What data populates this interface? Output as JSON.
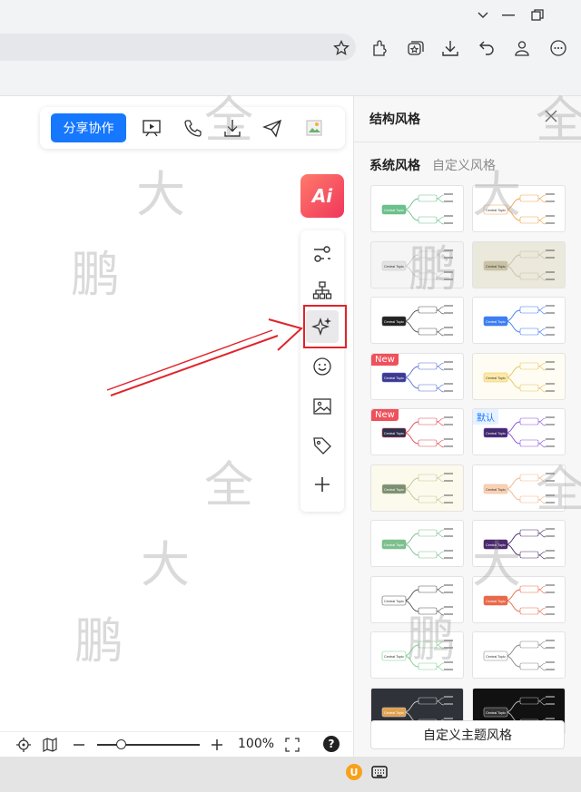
{
  "browser": {
    "controls": [
      "chevron-down-icon",
      "minimize-icon",
      "restore-icon"
    ],
    "toolbar_icons": [
      "star-icon",
      "extension-icon",
      "collections-icon",
      "download-icon",
      "undo-icon",
      "profile-icon",
      "more-icon"
    ]
  },
  "toolbar": {
    "share_label": "分享协作",
    "icons": [
      "present-icon",
      "phone-icon",
      "export-icon",
      "send-icon",
      "image-icon"
    ]
  },
  "ai_button": {
    "label": "Ai"
  },
  "side_tools": [
    "adjust-icon",
    "structure-icon",
    "magic-style-icon",
    "emoji-icon",
    "picture-icon",
    "tag-icon",
    "plus-icon"
  ],
  "bottom_bar": {
    "zoom_text": "100%",
    "zoom_level": 0.2,
    "help": "?"
  },
  "panel": {
    "title": "结构风格",
    "tab_system": "系统风格",
    "tab_custom": "自定义风格",
    "custom_theme_button": "自定义主题风格",
    "themes": [
      {
        "id": 1,
        "bg": "#ffffff",
        "center": "#6cc08b",
        "branch": "#6cc08b",
        "text": "Central Topic",
        "badge": ""
      },
      {
        "id": 2,
        "bg": "#ffffff",
        "center": "#ffffff",
        "branch": "#f0a24b",
        "text": "Central Topic",
        "badge": ""
      },
      {
        "id": 3,
        "bg": "#f5f5f5",
        "center": "#e3e3e3",
        "branch": "#cccccc",
        "text": "Central Topic",
        "badge": ""
      },
      {
        "id": 4,
        "bg": "#ebe8dc",
        "center": "#c9c2a5",
        "branch": "#c9c2a5",
        "text": "Central Topic",
        "badge": ""
      },
      {
        "id": 5,
        "bg": "#ffffff",
        "center": "#222222",
        "branch": "#555555",
        "text": "Central Topic",
        "badge": ""
      },
      {
        "id": 6,
        "bg": "#ffffff",
        "center": "#3e7ef2",
        "branch": "#3e7ef2",
        "text": "Central Topic",
        "badge": ""
      },
      {
        "id": 7,
        "bg": "#ffffff",
        "center": "#3d3b8e",
        "branch": "#5a6fd8",
        "text": "Central Topic",
        "badge": "New"
      },
      {
        "id": 8,
        "bg": "#fffdf3",
        "center": "#fde9a8",
        "branch": "#e8c25a",
        "text": "Central Topic",
        "badge": ""
      },
      {
        "id": 9,
        "bg": "#ffffff",
        "center": "#2c2f4a",
        "branch": "#e04a55",
        "text": "Central Topic",
        "badge": "New"
      },
      {
        "id": 10,
        "bg": "#ffffff",
        "center": "#3f2a6b",
        "branch": "#8a4fe0",
        "text": "Central Topic",
        "badge": "默认"
      },
      {
        "id": 11,
        "bg": "#fbfaec",
        "center": "#7a8f72",
        "branch": "#c4c59a",
        "text": "Central Topic",
        "badge": ""
      },
      {
        "id": 12,
        "bg": "#ffffff",
        "center": "#f8d2b5",
        "branch": "#f2b488",
        "text": "Central Topic",
        "badge": ""
      },
      {
        "id": 13,
        "bg": "#ffffff",
        "center": "#7cc08e",
        "branch": "#7cc08e",
        "text": "Central Topic",
        "badge": ""
      },
      {
        "id": 14,
        "bg": "#ffffff",
        "center": "#4b2a6e",
        "branch": "#4b2a6e",
        "text": "Central Topic",
        "badge": ""
      },
      {
        "id": 15,
        "bg": "#ffffff",
        "center": "#ffffff",
        "branch": "#555555",
        "text": "Central Topic",
        "badge": ""
      },
      {
        "id": 16,
        "bg": "#ffffff",
        "center": "#e96a4a",
        "branch": "#e96a4a",
        "text": "Central Topic",
        "badge": ""
      },
      {
        "id": 17,
        "bg": "#ffffff",
        "center": "#ffffff",
        "branch": "#7cd08a",
        "text": "Central Topic",
        "badge": ""
      },
      {
        "id": 18,
        "bg": "#ffffff",
        "center": "#ffffff",
        "branch": "#888888",
        "text": "Central Topic",
        "badge": ""
      },
      {
        "id": 19,
        "bg": "#2f3238",
        "center": "#e0a250",
        "branch": "#cccccc",
        "text": "Central Topic",
        "badge": ""
      },
      {
        "id": 20,
        "bg": "#111111",
        "center": "#333333",
        "branch": "#bbbbbb",
        "text": "Central Topic",
        "badge": ""
      }
    ]
  },
  "watermark": {
    "chars": [
      "鹏",
      "大",
      "全"
    ]
  },
  "taskbar": {
    "u_label": "U"
  }
}
